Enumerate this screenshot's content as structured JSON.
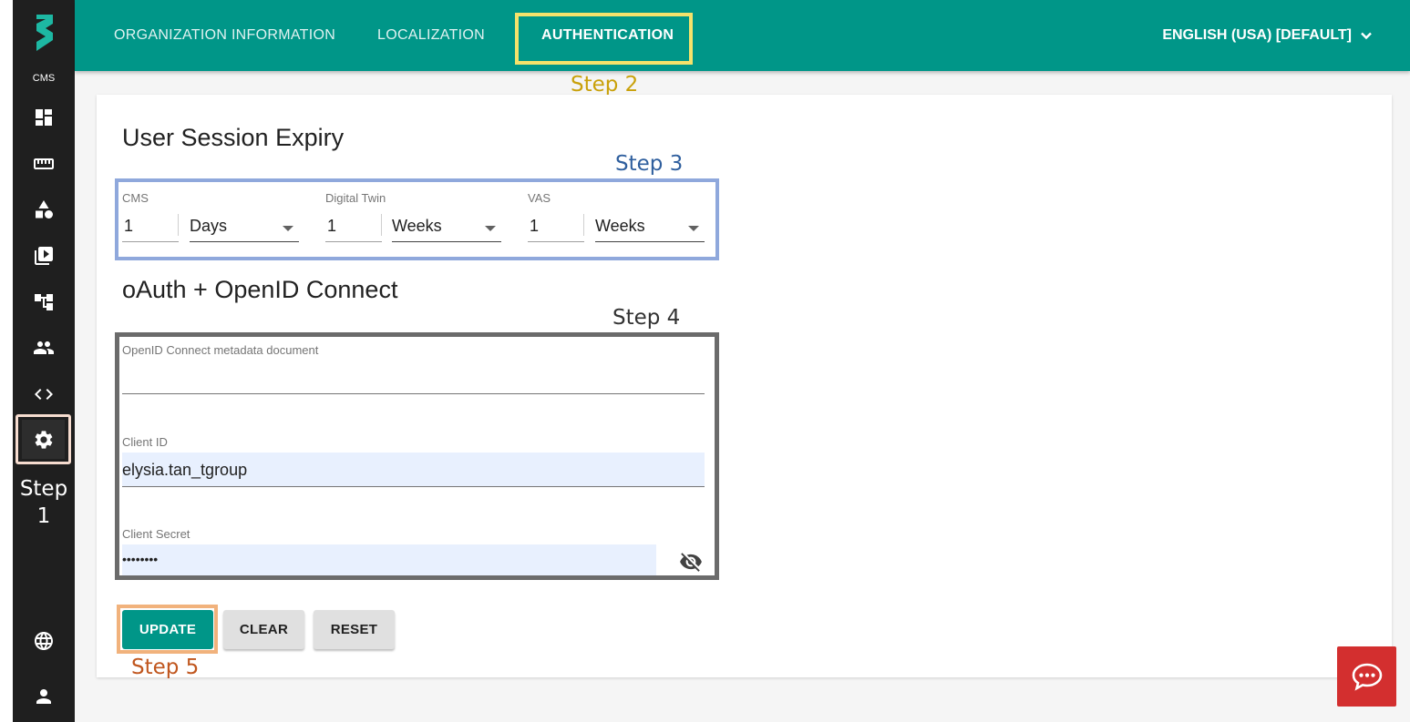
{
  "sidebar": {
    "cms_label": "CMS",
    "items": [
      {
        "icon": "dashboard-icon"
      },
      {
        "icon": "ruler-icon"
      },
      {
        "icon": "shapes-icon"
      },
      {
        "icon": "media-library-icon"
      },
      {
        "icon": "hierarchy-icon"
      },
      {
        "icon": "users-icon"
      },
      {
        "icon": "code-icon"
      },
      {
        "icon": "settings-gear-icon"
      },
      {
        "icon": "globe-icon"
      },
      {
        "icon": "account-icon"
      }
    ],
    "step_label": "Step 1"
  },
  "topbar": {
    "tabs": [
      {
        "label": "ORGANIZATION INFORMATION"
      },
      {
        "label": "LOCALIZATION"
      },
      {
        "label": "AUTHENTICATION"
      }
    ],
    "language": "ENGLISH (USA) [DEFAULT]",
    "color": "#009688"
  },
  "steps": {
    "step2": "Step 2",
    "step3": "Step 3",
    "step4": "Step 4",
    "step5": "Step 5"
  },
  "session": {
    "title": "User Session Expiry",
    "fields": [
      {
        "label": "CMS",
        "value": "1",
        "unit": "Days"
      },
      {
        "label": "Digital Twin",
        "value": "1",
        "unit": "Weeks"
      },
      {
        "label": "VAS",
        "value": "1",
        "unit": "Weeks"
      }
    ]
  },
  "oauth": {
    "title": "oAuth + OpenID Connect",
    "metadata_label": "OpenID Connect metadata document",
    "metadata_value": "",
    "client_id_label": "Client ID",
    "client_id_value": "elysia.tan_tgroup",
    "client_secret_label": "Client Secret",
    "client_secret_value": "••••••••"
  },
  "actions": {
    "update": "UPDATE",
    "clear": "CLEAR",
    "reset": "RESET"
  }
}
